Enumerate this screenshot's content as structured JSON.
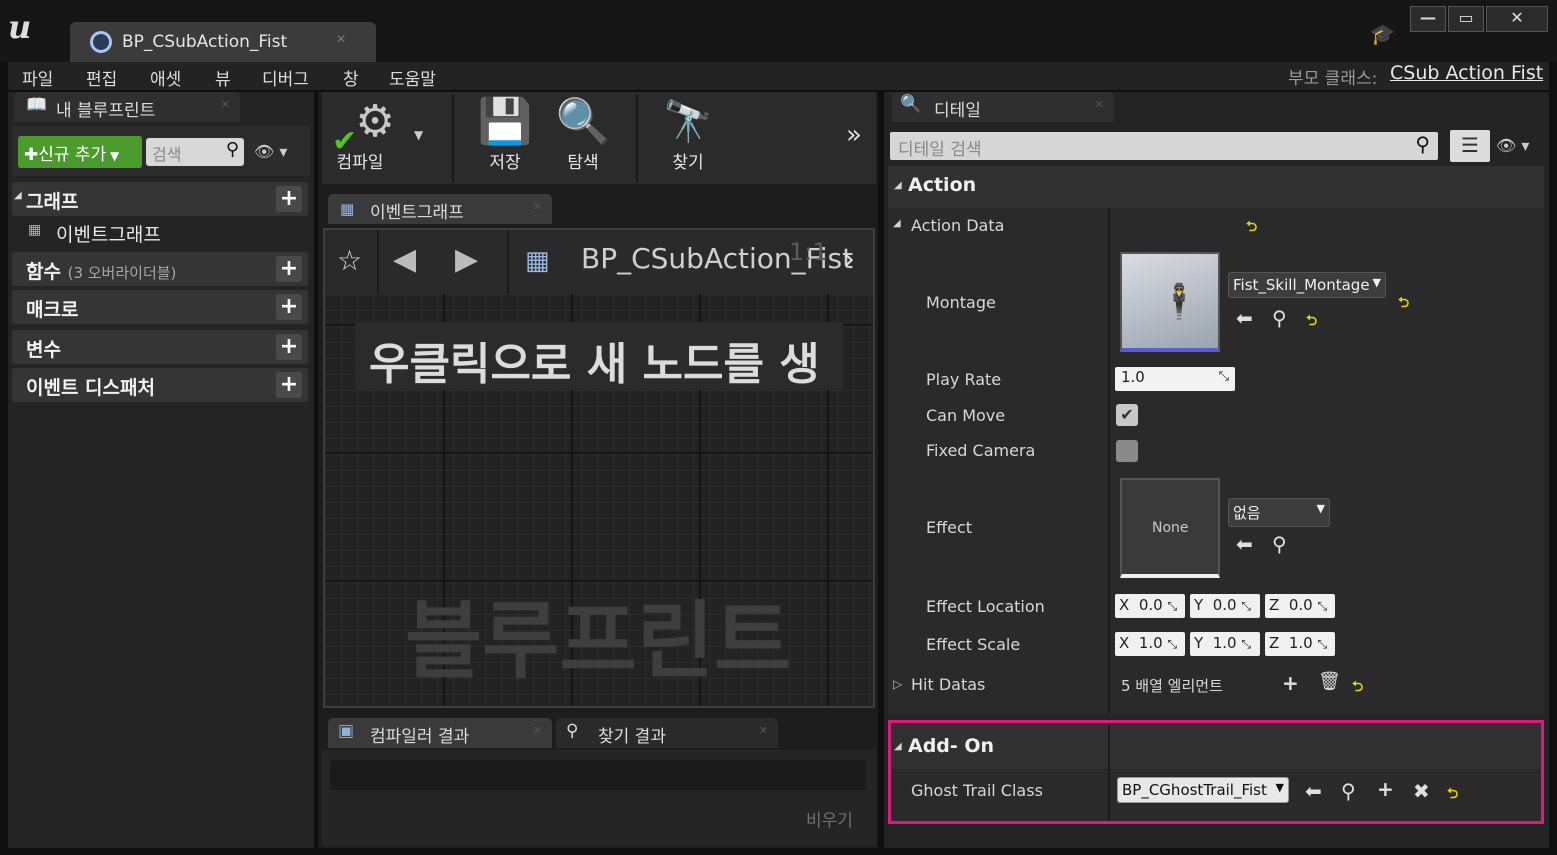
{
  "window": {
    "doc_tab": "BP_CSubAction_Fist",
    "parent_class_label": "부모 클래스:",
    "parent_class_value": "CSub Action Fist"
  },
  "menu": [
    "파일",
    "편집",
    "애셋",
    "뷰",
    "디버그",
    "창",
    "도움말"
  ],
  "my_blueprint": {
    "tab_title": "내 블루프린트",
    "add_new": "신규 추가",
    "search_placeholder": "검색",
    "categories": {
      "graph": "그래프",
      "event_graph": "이벤트그래프",
      "functions": "함수",
      "functions_sub": "(3 오버라이더블)",
      "macros": "매크로",
      "variables": "변수",
      "event_dispatchers": "이벤트 디스패처"
    }
  },
  "toolbar": {
    "compile": "컴파일",
    "save": "저장",
    "browse": "탐색",
    "find": "찾기"
  },
  "graph": {
    "tab_title": "이벤트그래프",
    "breadcrumb": "BP_CSubAction_Fist",
    "zoom": "1:1",
    "hint": "우클릭으로 새 노드를 생",
    "watermark": "블루프린트"
  },
  "bottom": {
    "compiler_tab": "컴파일러 결과",
    "find_tab": "찾기 결과",
    "clear": "비우기"
  },
  "details": {
    "tab_title": "디테일",
    "search_placeholder": "디테일 검색",
    "section_action": "Action",
    "action_data": "Action Data",
    "montage_label": "Montage",
    "montage_value": "Fist_Skill_Montage",
    "play_rate_label": "Play Rate",
    "play_rate_value": "1.0",
    "can_move_label": "Can Move",
    "can_move": true,
    "fixed_camera_label": "Fixed Camera",
    "fixed_camera": false,
    "effect_label": "Effect",
    "effect_thumb": "None",
    "effect_value": "없음",
    "effect_location_label": "Effect Location",
    "effect_location": {
      "x": "X",
      "xv": "0.0",
      "y": "Y",
      "yv": "0.0",
      "z": "Z",
      "zv": "0.0"
    },
    "effect_scale_label": "Effect Scale",
    "effect_scale": {
      "x": "X",
      "xv": "1.0",
      "y": "Y",
      "yv": "1.0",
      "z": "Z",
      "zv": "1.0"
    },
    "hit_datas_label": "Hit Datas",
    "hit_datas_value": "5 배열 엘리먼트",
    "section_addon": "Add- On",
    "ghost_trail_label": "Ghost Trail Class",
    "ghost_trail_value": "BP_CGhostTrail_Fist",
    "highlight_color": "#e0197d"
  }
}
